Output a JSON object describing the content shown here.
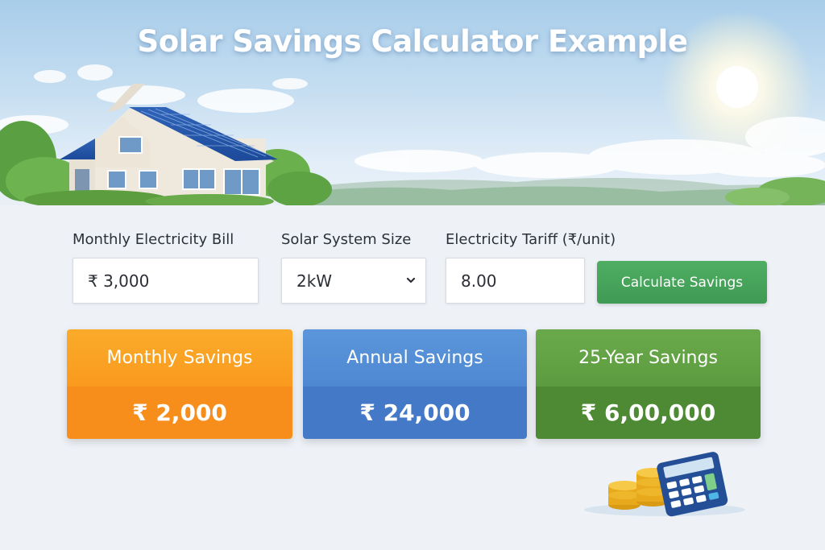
{
  "header": {
    "title": "Solar Savings Calculator Example"
  },
  "form": {
    "monthly_bill": {
      "label": "Monthly Electricity Bill",
      "value": "₹ 3,000"
    },
    "system_size": {
      "label": "Solar System Size",
      "value": "2kW"
    },
    "tariff": {
      "label": "Electricity Tariff  (₹/unit)",
      "value": "8.00"
    },
    "calculate_button": "Calculate Savings"
  },
  "results": [
    {
      "title": "Monthly Savings",
      "value": "₹ 2,000",
      "color": "#f99a1e"
    },
    {
      "title": "Annual Savings",
      "value": "₹ 24,000",
      "color": "#4e88d2"
    },
    {
      "title": "25-Year Savings",
      "value": "₹ 6,00,000",
      "color": "#5c9c40"
    }
  ],
  "icons": [
    "chevron-down-icon",
    "house-solar-illustration",
    "sun-icon",
    "calculator-icon",
    "coins-icon"
  ],
  "colors": {
    "accent_green": "#4aa55d",
    "orange": "#f99a1e",
    "blue": "#4e88d2",
    "green": "#5c9c40"
  }
}
